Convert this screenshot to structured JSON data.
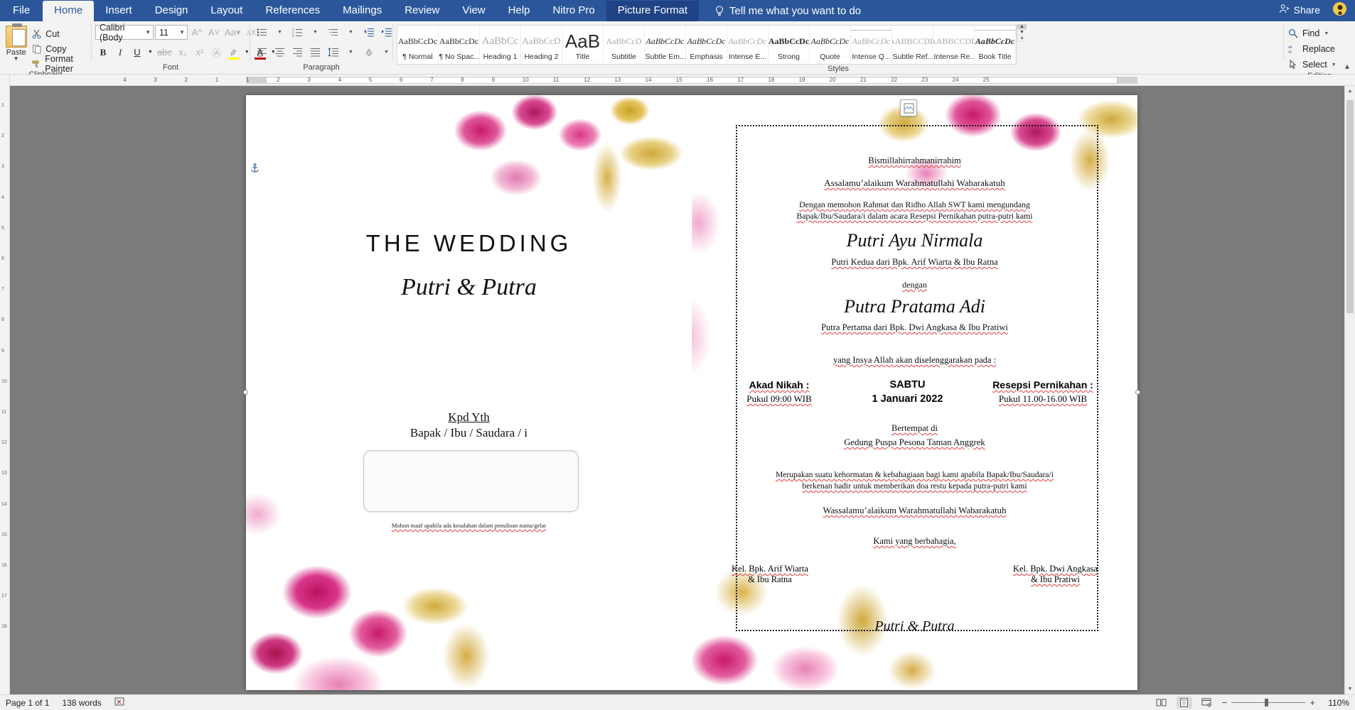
{
  "titlebar": {
    "tabs": [
      {
        "label": "File",
        "kind": "file"
      },
      {
        "label": "Home",
        "kind": "active"
      },
      {
        "label": "Insert",
        "kind": "normal"
      },
      {
        "label": "Design",
        "kind": "normal"
      },
      {
        "label": "Layout",
        "kind": "normal"
      },
      {
        "label": "References",
        "kind": "normal"
      },
      {
        "label": "Mailings",
        "kind": "normal"
      },
      {
        "label": "Review",
        "kind": "normal"
      },
      {
        "label": "View",
        "kind": "normal"
      },
      {
        "label": "Help",
        "kind": "normal"
      },
      {
        "label": "Nitro Pro",
        "kind": "normal"
      },
      {
        "label": "Picture Format",
        "kind": "contextual"
      }
    ],
    "tell_me": "Tell me what you want to do",
    "tell_me_icon": "lightbulb-icon",
    "share_label": "Share",
    "share_icon": "share-person-icon",
    "account_icon": "user-avatar",
    "accent_color": "#2b579a",
    "contextual_color": "#1f4384"
  },
  "ribbon": {
    "clipboard": {
      "group_label": "Clipboard",
      "paste_label": "Paste",
      "items": [
        {
          "label": "Cut",
          "icon": "scissors-icon"
        },
        {
          "label": "Copy",
          "icon": "copy-icon"
        },
        {
          "label": "Format Painter",
          "icon": "format-painter-icon"
        }
      ]
    },
    "font": {
      "group_label": "Font",
      "font_name": "Calibri (Body",
      "font_size": "11",
      "buttons_row1": [
        "grow-font-icon",
        "shrink-font-icon",
        "change-case-icon",
        "clear-formatting-icon"
      ],
      "buttons_row2": [
        "bold-icon",
        "italic-icon",
        "underline-icon",
        "strikethrough-icon",
        "subscript-icon",
        "superscript-icon",
        "text-effects-icon",
        "text-highlight-icon",
        "font-color-icon"
      ],
      "highlight_color": "#ffff00",
      "font_color": "#c00000"
    },
    "paragraph": {
      "group_label": "Paragraph",
      "buttons_row1": [
        "bullets-icon",
        "numbering-icon",
        "multilevel-list-icon",
        "decrease-indent-icon",
        "increase-indent-icon",
        "sort-icon",
        "show-marks-icon"
      ],
      "buttons_row2": [
        "align-left-icon",
        "align-center-icon",
        "align-right-icon",
        "justify-icon",
        "line-spacing-icon",
        "shading-icon",
        "borders-icon"
      ]
    },
    "styles": {
      "group_label": "Styles",
      "gallery": [
        {
          "preview": "AaBbCcDc",
          "name": "¶ Normal"
        },
        {
          "preview": "AaBbCcDc",
          "name": "¶ No Spac..."
        },
        {
          "preview": "AaBbCc",
          "name": "Heading 1"
        },
        {
          "preview": "AaBbCcD",
          "name": "Heading 2"
        },
        {
          "preview": "AaB",
          "name": "Title"
        },
        {
          "preview": "AaBbCcD",
          "name": "Subtitle"
        },
        {
          "preview": "AaBbCcDc",
          "name": "Subtle Em..."
        },
        {
          "preview": "AaBbCcDc",
          "name": "Emphasis"
        },
        {
          "preview": "AaBbCcDc",
          "name": "Intense E..."
        },
        {
          "preview": "AaBbCcDc",
          "name": "Strong"
        },
        {
          "preview": "AaBbCcDc",
          "name": "Quote"
        },
        {
          "preview": "AaBbCcDc",
          "name": "Intense Q..."
        },
        {
          "preview": "AABBCCDD",
          "name": "Subtle Ref..."
        },
        {
          "preview": "AABBCCDD",
          "name": "Intense Re..."
        },
        {
          "preview": "AaBbCcDc",
          "name": "Book Title"
        }
      ]
    },
    "editing": {
      "group_label": "Editing",
      "items": [
        {
          "label": "Find",
          "icon": "magnifier-icon",
          "caret": true
        },
        {
          "label": "Replace",
          "icon": "replace-icon",
          "caret": false
        },
        {
          "label": "Select",
          "icon": "select-arrow-icon",
          "caret": true
        }
      ]
    }
  },
  "rulers": {
    "horizontal_ticks": [
      "4",
      "3",
      "2",
      "1",
      "1",
      "2",
      "3",
      "4",
      "5",
      "6",
      "7",
      "8",
      "9",
      "10",
      "11",
      "12",
      "13",
      "14",
      "15",
      "16",
      "17",
      "18",
      "19",
      "20",
      "21",
      "22",
      "23",
      "24",
      "25"
    ],
    "vertical_ticks": [
      "1",
      "2",
      "3",
      "4",
      "5",
      "6",
      "7",
      "8",
      "9",
      "10",
      "11",
      "12",
      "13",
      "14",
      "15",
      "16",
      "17",
      "18"
    ]
  },
  "document": {
    "left_page": {
      "title": "THE WEDDING",
      "couple": "Putri & Putra",
      "recipient_heading": "Kpd Yth",
      "recipient_line": "Bapak / Ibu / Saudara / i",
      "name_box_value": "",
      "disclaimer": "Mohon maaf apabila ada kesalahan dalam penulisan nama/gelar"
    },
    "right_page": {
      "bismillah": "Bismillahirrahmanirrahim",
      "salam": "Assalamu’alaikum Warahmatullahi Wabarakatuh",
      "intro_line1": "Dengan memohon Rahmat dan Ridho Allah SWT kami mengundang",
      "intro_line2": "Bapak/Ibu/Saudara/i dalam acara Resepsi Pernikahan putra-putri kami",
      "bride_name": "Putri Ayu Nirmala",
      "bride_parents": "Putri Kedua dari Bpk. Arif Wiarta & Ibu Ratna",
      "joiner": "dengan",
      "groom_name": "Putra Pratama Adi",
      "groom_parents": "Putra Pertama dari Bpk. Dwi Angkasa & Ibu Pratiwi",
      "schedule_intro": "yang Insya Allah akan diselenggarakan pada :",
      "akad_heading": "Akad Nikah :",
      "akad_time": "Pukul 09:00 WIB",
      "day": "SABTU",
      "date": "1 Januari 2022",
      "resepsi_heading": "Resepsi Pernikahan :",
      "resepsi_time": "Pukul 11.00-16.00 WIB",
      "venue_label": "Bertempat di",
      "venue_name": "Gedung Puspa Pesona Taman Anggrek",
      "closing_line1": "Merupakan suatu kehormatan & kebahagiaan bagi kami apabila Bapak/Ibu/Saudara/i",
      "closing_line2": "berkenan hadir untuk memberikan doa restu kepada putra-putri kami",
      "wassalam": "Wassalamu’alaikum Warahmatullahi Wabarakatuh",
      "regards": "Kami yang berbahagia,",
      "family_left_line1": "Kel. Bpk. Arif Wiarta",
      "family_left_line2": "& Ibu Ratna",
      "family_right_line1": "Kel. Bpk. Dwi Angkasa",
      "family_right_line2": "& Ibu Pratiwi",
      "footer_script": "Putri & Putra"
    }
  },
  "statusbar": {
    "page_label": "Page 1 of 1",
    "word_count": "138 words",
    "proofing_icon": "proofing-errors-icon",
    "view_buttons": [
      "read-mode-icon",
      "print-layout-icon",
      "web-layout-icon"
    ],
    "zoom_out_icon": "zoom-out-icon",
    "zoom_in_icon": "zoom-in-icon",
    "zoom_level": "110%"
  }
}
